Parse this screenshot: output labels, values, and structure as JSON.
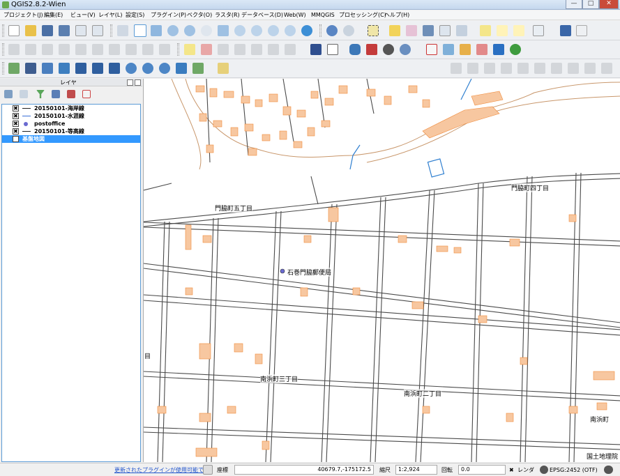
{
  "window": {
    "title": "QGIS2.8.2-Wien",
    "min": "—",
    "max": "□",
    "close": "✕"
  },
  "menu": [
    "プロジェクト(J)",
    "編集(E)",
    "ビュー(V)",
    "レイヤ(L)",
    "設定(S)",
    "プラグイン(P)",
    "ベクタ(O)",
    "ラスタ(R)",
    "データベース(D)",
    "Web(W)",
    "MMQGIS",
    "プロセッシング(C)",
    "ヘルプ(H)"
  ],
  "layers_panel": {
    "title": "レイヤ",
    "items": [
      {
        "label": "20150101-海岸線",
        "checked": "✖",
        "symbol": "line",
        "color": "#222222"
      },
      {
        "label": "20150101-水涯線",
        "checked": "✖",
        "symbol": "line",
        "color": "#3a6fd8"
      },
      {
        "label": "postoffice",
        "checked": "✖",
        "symbol": "point",
        "color": "#6a6ad0"
      },
      {
        "label": "20150101-等高線",
        "checked": "✖",
        "symbol": "line",
        "color": "#222222"
      },
      {
        "label": "基盤地図",
        "checked": "✖",
        "symbol": "none",
        "color": "#ffffff",
        "selected": true
      }
    ]
  },
  "map": {
    "labels": [
      "門脇町五丁目",
      "門脇町四丁目",
      "石巻門脇郵便局",
      "南浜町三丁目",
      "南浜町二丁目",
      "南浜町",
      "国土地理院",
      "目"
    ],
    "colors": {
      "building": "#f7c7a0",
      "building_edge": "#f08a3a",
      "road": "#4a4a4a",
      "contour": "#c8966a",
      "water": "#2f7fd0"
    }
  },
  "status": {
    "plugin_notice": "更新されたプラグインが使用可能です",
    "coord_label": "座標",
    "coord_value": "40679.7,-175172.5",
    "scale_label": "縮尺",
    "scale_value": "1:2,924",
    "rotation_label": "回転",
    "rotation_value": "0.0",
    "render_label": "レンダ",
    "render_check": "✖",
    "crs": "EPSG:2452 (OTF)"
  }
}
